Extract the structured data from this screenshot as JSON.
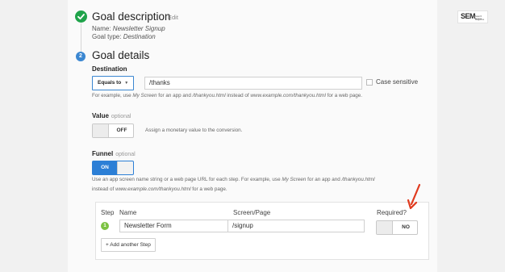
{
  "goal_description": {
    "title": "Goal description",
    "edit_label": "Edit",
    "name_label": "Name:",
    "name_value": "Newsletter Signup",
    "type_label": "Goal type:",
    "type_value": "Destination"
  },
  "goal_details": {
    "step_number": "2",
    "title": "Goal details"
  },
  "destination": {
    "label": "Destination",
    "match_type": "Equals to",
    "value": "/thanks",
    "case_sensitive_label": "Case sensitive",
    "help": {
      "t1": "For example, use ",
      "e1": "My Screen",
      "t2": " for an app and ",
      "e2": "/thankyou.html",
      "t3": " instead of ",
      "e3": "www.example.com/thankyou.html",
      "t4": " for a web page."
    }
  },
  "value_section": {
    "label": "Value",
    "optional": "optional",
    "toggle_label": "OFF",
    "help": "Assign a monetary value to the conversion."
  },
  "funnel": {
    "label": "Funnel",
    "optional": "optional",
    "toggle_label": "ON",
    "help1": {
      "t1": "Use an app screen name string or a web page URL for each step. For example, use ",
      "e1": "My Screen",
      "t2": " for an app and ",
      "e2": "/thankyou.html"
    },
    "help2": {
      "t1": "instead of ",
      "e1": "www.example.com/thankyou.html",
      "t2": " for a web page."
    },
    "columns": {
      "step": "Step",
      "name": "Name",
      "screen": "Screen/Page",
      "required": "Required?"
    },
    "rows": [
      {
        "step": "1",
        "name": "Newsletter Form",
        "screen": "/signup",
        "required": "NO"
      }
    ],
    "add_step_label": "+ Add another Step"
  },
  "logo": {
    "main": "SEM",
    "line1": "Search Engine",
    "line2": "Magazine"
  },
  "colors": {
    "accent_blue": "#2c7fd6",
    "check_green": "#1fa34a",
    "step_green": "#7cc242",
    "arrow_red": "#e03a1e"
  }
}
